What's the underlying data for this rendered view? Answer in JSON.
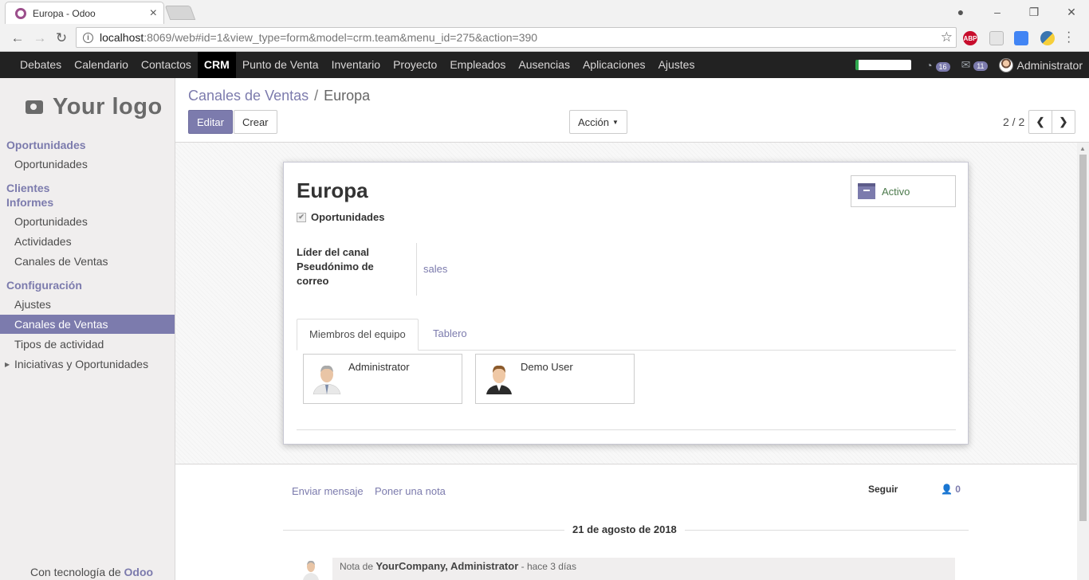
{
  "browser": {
    "tab_title": "Europa - Odoo",
    "url_host": "localhost",
    "url_rest": ":8069/web#id=1&view_type=form&model=crm.team&menu_id=275&action=390",
    "ext_abp": "ABP"
  },
  "topnav": {
    "apps": [
      "Debates",
      "Calendario",
      "Contactos",
      "CRM",
      "Punto de Venta",
      "Inventario",
      "Proyecto",
      "Empleados",
      "Ausencias",
      "Aplicaciones",
      "Ajustes"
    ],
    "active_app": "CRM",
    "badge_activities": "16",
    "badge_messages": "11",
    "user_name": "Administrator"
  },
  "sidebar": {
    "logo_text": "Your logo",
    "sec_opportunities": "Oportunidades",
    "item_opportunities": "Oportunidades",
    "sec_clients": "Clientes",
    "sec_reports": "Informes",
    "report_opportunities": "Oportunidades",
    "report_activities": "Actividades",
    "report_channels": "Canales de Ventas",
    "sec_config": "Configuración",
    "config_settings": "Ajustes",
    "config_channels": "Canales de Ventas",
    "config_activity_types": "Tipos de actividad",
    "config_initiatives": "Iniciativas y Oportunidades",
    "powered_prefix": "Con tecnología de",
    "powered_brand": "Odoo"
  },
  "control_panel": {
    "breadcrumb_parent": "Canales de Ventas",
    "breadcrumb_sep": "/",
    "breadcrumb_current": "Europa",
    "edit_label": "Editar",
    "create_label": "Crear",
    "action_label": "Acción",
    "pager_value": "2 / 2"
  },
  "form": {
    "title": "Europa",
    "opportunities_label": "Oportunidades",
    "opportunities_checked": true,
    "active_button_label": "Activo",
    "leader_label": "Líder del canal",
    "alias_label": "Pseudónimo de correo",
    "alias_value": "sales",
    "tab_members": "Miembros del equipo",
    "tab_dashboard": "Tablero",
    "members": [
      {
        "name": "Administrator"
      },
      {
        "name": "Demo User"
      }
    ]
  },
  "chatter": {
    "send_message": "Enviar mensaje",
    "log_note": "Poner una nota",
    "follow": "Seguir",
    "followers_count": "0",
    "date_separator": "21 de agosto de 2018",
    "message_prefix": "Nota de",
    "message_author": "YourCompany, Administrator",
    "message_time": "- hace 3 días"
  },
  "colors": {
    "primary": "#7c7bad",
    "topbar": "#222222",
    "sidebar_bg": "#f0eeee"
  }
}
